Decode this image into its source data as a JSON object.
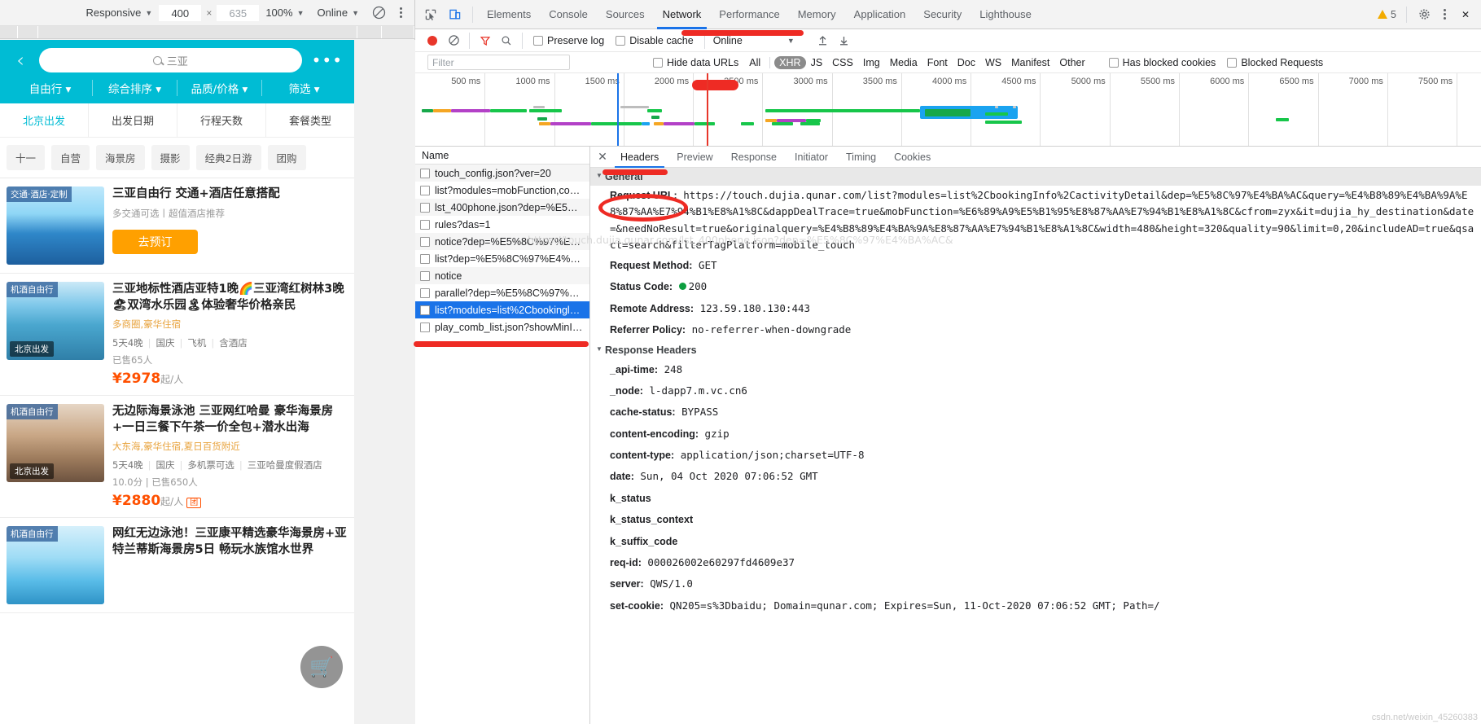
{
  "device_toolbar": {
    "device": "Responsive",
    "width": "400",
    "height": "635",
    "zoom": "100%",
    "network": "Online",
    "rotate_icon": "rotate-icon",
    "more_icon": "kebab-menu-icon"
  },
  "phone": {
    "search_placeholder": "三亚",
    "back_icon": "back-chevron-icon",
    "more_icon": "ellipsis-icon",
    "search_icon": "search-icon",
    "filters": [
      "自由行",
      "综合排序",
      "品质/价格",
      "筛选"
    ],
    "subfilters": [
      "北京出发",
      "出发日期",
      "行程天数",
      "套餐类型"
    ],
    "tags": [
      "十一",
      "自营",
      "海景房",
      "摄影",
      "经典2日游",
      "团购"
    ],
    "cart_icon": "shopping-cart-icon",
    "cards": [
      {
        "badge": "交通·酒店·定制",
        "title": "三亚自由行 交通+酒店任意搭配",
        "sub": "多交通可选丨超值酒店推荐",
        "button": "去预订"
      },
      {
        "badge": "机酒自由行",
        "badge2": "北京出发",
        "title": "三亚地标性酒店亚特1晚🌈三亚湾红树林3晚🏖双湾水乐园🏝体验奢华价格亲民",
        "sub": "多商圈,豪华住宿",
        "meta": [
          "5天4晚",
          "国庆",
          "飞机",
          "含酒店"
        ],
        "sold": "已售65人",
        "price": "¥2978",
        "price_unit": "起/人"
      },
      {
        "badge": "机酒自由行",
        "badge2": "北京出发",
        "title": "无边际海景泳池 三亚网红哈曼 豪华海景房+一日三餐下午茶一价全包+潜水出海",
        "sub": "大东海,豪华住宿,夏日百货附近",
        "meta": [
          "5天4晚",
          "国庆",
          "多机票可选",
          "三亚哈曼度假酒店"
        ],
        "score": "10.0分",
        "sold": "已售650人",
        "price": "¥2880",
        "price_unit": "起/人",
        "tuan": "团"
      },
      {
        "badge": "机酒自由行",
        "title": "网红无边泳池！三亚康平精选豪华海景房+亚特兰蒂斯海景房5日 畅玩水族馆水世界"
      }
    ]
  },
  "devtools": {
    "inspect_icon": "inspect-element-icon",
    "device_icon": "device-toolbar-icon",
    "tabs": [
      "Elements",
      "Console",
      "Sources",
      "Network",
      "Performance",
      "Memory",
      "Application",
      "Security",
      "Lighthouse"
    ],
    "selected_tab": "Network",
    "warning_count": "5",
    "settings_icon": "gear-icon",
    "more_icon": "kebab-menu-icon",
    "close_icon": "close-icon",
    "toolbar": {
      "record_icon": "record-button-icon",
      "clear_icon": "clear-network-icon",
      "filter_icon": "filter-funnel-icon",
      "search_icon": "search-icon",
      "preserve_log": "Preserve log",
      "disable_cache": "Disable cache",
      "throttle": "Online",
      "import_icon": "import-har-icon",
      "export_icon": "export-har-icon"
    },
    "filter_bar": {
      "placeholder": "Filter",
      "hide_data_urls": "Hide data URLs",
      "types": [
        "All",
        "XHR",
        "JS",
        "CSS",
        "Img",
        "Media",
        "Font",
        "Doc",
        "WS",
        "Manifest",
        "Other"
      ],
      "active_type": "XHR",
      "has_blocked_cookies": "Has blocked cookies",
      "blocked_requests": "Blocked Requests"
    },
    "overview": {
      "ticks": [
        "500 ms",
        "1000 ms",
        "1500 ms",
        "2000 ms",
        "2500 ms",
        "3000 ms",
        "3500 ms",
        "4000 ms",
        "4500 ms",
        "5000 ms",
        "5500 ms",
        "6000 ms",
        "6500 ms",
        "7000 ms",
        "7500 ms"
      ]
    },
    "list": {
      "column_header": "Name",
      "rows": [
        {
          "name": "touch_config.json?ver=20",
          "selected": false
        },
        {
          "name": "list?modules=mobFunction,co…",
          "selected": false
        },
        {
          "name": "lst_400phone.json?dep=%E5%…",
          "selected": false
        },
        {
          "name": "rules?das=1",
          "selected": false
        },
        {
          "name": "notice?dep=%E5%8C%97%E4…",
          "selected": false
        },
        {
          "name": "list?dep=%E5%8C%97%E4%B…",
          "selected": false
        },
        {
          "name": "notice",
          "selected": false
        },
        {
          "name": "parallel?dep=%E5%8C%97%E…",
          "selected": false
        },
        {
          "name": "list?modules=list%2Cbookingl…",
          "selected": true
        },
        {
          "name": "play_comb_list.json?showMinI…",
          "selected": false
        }
      ],
      "tooltip": "https://touch.dujia.qunar.com/lst_400phone.json?dep=%E5%8C%97%E4%BA%AC&"
    },
    "detail": {
      "tabs": [
        "Headers",
        "Preview",
        "Response",
        "Initiator",
        "Timing",
        "Cookies"
      ],
      "selected_tab": "Headers",
      "general_label": "General",
      "response_headers_label": "Response Headers",
      "request_url_label": "Request URL:",
      "request_url_value": "https://touch.dujia.qunar.com/list?modules=list%2CbookingInfo%2CactivityDetail&dep=%E5%8C%97%E4%BA%AC&query=%E4%B8%89%E4%BA%9A%E8%87%AA%E7%94%B1%E8%A1%8C&dappDealTrace=true&mobFunction=%E6%89%A9%E5%B1%95%E8%87%AA%E7%94%B1%E8%A1%8C&cfrom=zyx&it=dujia_hy_destination&date=&needNoResult=true&originalquery=%E4%B8%89%E4%BA%9A%E8%87%AA%E7%94%B1%E8%A1%8C&width=480&height=320&quality=90&limit=0,20&includeAD=true&qsact=search&filterTagPlatform=mobile_touch",
      "request_method_label": "Request Method:",
      "request_method_value": "GET",
      "status_code_label": "Status Code:",
      "status_code_value": "200",
      "remote_address_label": "Remote Address:",
      "remote_address_value": "123.59.180.130:443",
      "referrer_policy_label": "Referrer Policy:",
      "referrer_policy_value": "no-referrer-when-downgrade",
      "response_headers": [
        {
          "key": "_api-time:",
          "value": "248"
        },
        {
          "key": "_node:",
          "value": "l-dapp7.m.vc.cn6"
        },
        {
          "key": "cache-status:",
          "value": "BYPASS"
        },
        {
          "key": "content-encoding:",
          "value": "gzip"
        },
        {
          "key": "content-type:",
          "value": "application/json;charset=UTF-8"
        },
        {
          "key": "date:",
          "value": "Sun, 04 Oct 2020 07:06:52 GMT"
        },
        {
          "key": "k_status",
          "value": ""
        },
        {
          "key": "k_status_context",
          "value": ""
        },
        {
          "key": "k_suffix_code",
          "value": ""
        },
        {
          "key": "req-id:",
          "value": "000026002e60297fd4609e37"
        },
        {
          "key": "server:",
          "value": "QWS/1.0"
        },
        {
          "key": "set-cookie:",
          "value": "QN205=s%3Dbaidu; Domain=qunar.com; Expires=Sun, 11-Oct-2020 07:06:52 GMT; Path=/"
        }
      ]
    },
    "watermark": "csdn.net/weixin_45260383"
  },
  "colors": {
    "accent": "#1a73e8",
    "annotation": "#ee2b24",
    "phone_header": "#00bcd4",
    "price": "#ff5000"
  }
}
